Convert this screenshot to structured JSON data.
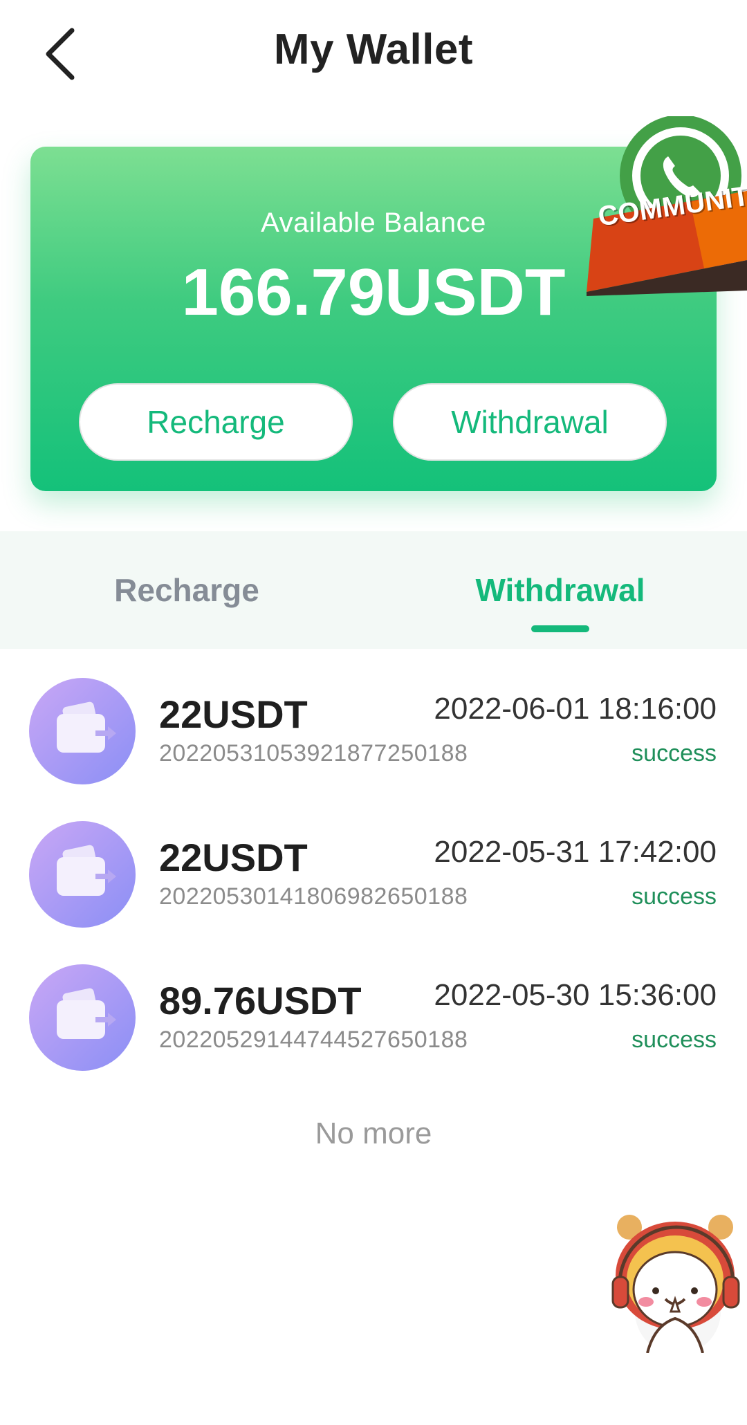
{
  "header": {
    "title": "My Wallet",
    "back_icon": "chevron-left-icon"
  },
  "balance_card": {
    "label": "Available Balance",
    "amount": "166.79USDT",
    "recharge_label": "Recharge",
    "withdraw_label": "Withdrawal",
    "gradient_top": "#7ddf92",
    "gradient_bottom": "#14c17a"
  },
  "community_badge": {
    "text": "COMMUNIT",
    "icon": "whatsapp-icon"
  },
  "tabs": {
    "recharge_label": "Recharge",
    "withdraw_label": "Withdrawal",
    "active": "Withdrawal",
    "active_color": "#14b97b",
    "inactive_color": "#858c96"
  },
  "records": [
    {
      "amount": "22USDT",
      "datetime": "2022-06-01 18:16:00",
      "order_id": "20220531053921877250188",
      "status": "success",
      "icon": "wallet-out-icon"
    },
    {
      "amount": "22USDT",
      "datetime": "2022-05-31 17:42:00",
      "order_id": "20220530141806982650188",
      "status": "success",
      "icon": "wallet-out-icon"
    },
    {
      "amount": "89.76USDT",
      "datetime": "2022-05-30 15:36:00",
      "order_id": "20220529144744527650188",
      "status": "success",
      "icon": "wallet-out-icon"
    }
  ],
  "footer": {
    "no_more": "No more"
  },
  "support": {
    "icon": "customer-service-mascot-icon"
  }
}
